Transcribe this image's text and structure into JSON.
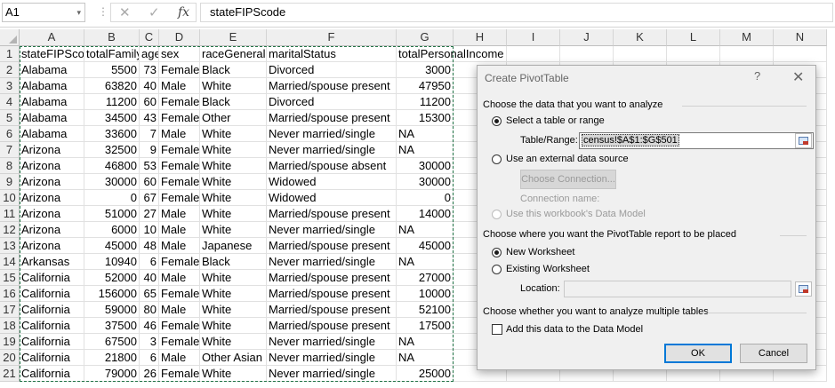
{
  "formula_bar": {
    "name_box": "A1",
    "name_box_dropdown_icon": "chevron-down-icon",
    "more_icon": "vertical-dots-icon",
    "cancel_icon": "close-icon",
    "enter_icon": "checkmark-icon",
    "function_icon": "fx",
    "content": "stateFIPScode"
  },
  "sheet": {
    "columns": [
      "A",
      "B",
      "C",
      "D",
      "E",
      "F",
      "G",
      "H",
      "I",
      "J",
      "K",
      "L",
      "M",
      "N"
    ],
    "header": [
      "stateFIPScode",
      "totalFamilyIncome",
      "age",
      "sex",
      "raceGeneral",
      "maritalStatus",
      "totalPersonalIncome"
    ],
    "rows": [
      [
        "Alabama",
        "5500",
        "73",
        "Female",
        "Black",
        "Divorced",
        "3000"
      ],
      [
        "Alabama",
        "63820",
        "40",
        "Male",
        "White",
        "Married/spouse present",
        "47950"
      ],
      [
        "Alabama",
        "11200",
        "60",
        "Female",
        "Black",
        "Divorced",
        "11200"
      ],
      [
        "Alabama",
        "34500",
        "43",
        "Female",
        "Other",
        "Married/spouse present",
        "15300"
      ],
      [
        "Alabama",
        "33600",
        "7",
        "Male",
        "White",
        "Never married/single",
        "NA"
      ],
      [
        "Arizona",
        "32500",
        "9",
        "Female",
        "White",
        "Never married/single",
        "NA"
      ],
      [
        "Arizona",
        "46800",
        "53",
        "Female",
        "White",
        "Married/spouse absent",
        "30000"
      ],
      [
        "Arizona",
        "30000",
        "60",
        "Female",
        "White",
        "Widowed",
        "30000"
      ],
      [
        "Arizona",
        "0",
        "67",
        "Female",
        "White",
        "Widowed",
        "0"
      ],
      [
        "Arizona",
        "51000",
        "27",
        "Male",
        "White",
        "Married/spouse present",
        "14000"
      ],
      [
        "Arizona",
        "6000",
        "10",
        "Male",
        "White",
        "Never married/single",
        "NA"
      ],
      [
        "Arizona",
        "45000",
        "48",
        "Male",
        "Japanese",
        "Married/spouse present",
        "45000"
      ],
      [
        "Arkansas",
        "10940",
        "6",
        "Female",
        "Black",
        "Never married/single",
        "NA"
      ],
      [
        "California",
        "52000",
        "40",
        "Male",
        "White",
        "Married/spouse present",
        "27000"
      ],
      [
        "California",
        "156000",
        "65",
        "Female",
        "White",
        "Married/spouse present",
        "10000"
      ],
      [
        "California",
        "59000",
        "80",
        "Male",
        "White",
        "Married/spouse present",
        "52100"
      ],
      [
        "California",
        "37500",
        "46",
        "Female",
        "White",
        "Married/spouse present",
        "17500"
      ],
      [
        "California",
        "67500",
        "3",
        "Female",
        "White",
        "Never married/single",
        "NA"
      ],
      [
        "California",
        "21800",
        "6",
        "Male",
        "Other Asian or Pacific Islander",
        "Never married/single",
        "NA"
      ],
      [
        "California",
        "79000",
        "26",
        "Female",
        "White",
        "Never married/single",
        "25000"
      ]
    ],
    "marquee_color": "#217346"
  },
  "dialog": {
    "title": "Create PivotTable",
    "help_label": "?",
    "close_icon": "close-icon",
    "section_choose_data": "Choose the data that you want to analyze",
    "option_select_table": "Select a table or range",
    "table_range_label": "Table/Range:",
    "table_range_value": "census!$A$1:$G$501",
    "option_external": "Use an external data source",
    "choose_connection_button": "Choose Connection...",
    "connection_name_label": "Connection name:",
    "option_data_model": "Use this workbook's Data Model",
    "section_placement": "Choose where you want the PivotTable report to be placed",
    "option_new_worksheet": "New Worksheet",
    "option_existing_worksheet": "Existing Worksheet",
    "location_label": "Location:",
    "location_value": "",
    "section_multiple": "Choose whether you want to analyze multiple tables",
    "add_to_data_model": "Add this data to the Data Model",
    "add_to_data_model_checked": false,
    "selected_data_option": "Select a table or range",
    "selected_placement_option": "New Worksheet",
    "ok_label": "OK",
    "cancel_label": "Cancel",
    "range_selector_icon": "range-select-icon"
  }
}
